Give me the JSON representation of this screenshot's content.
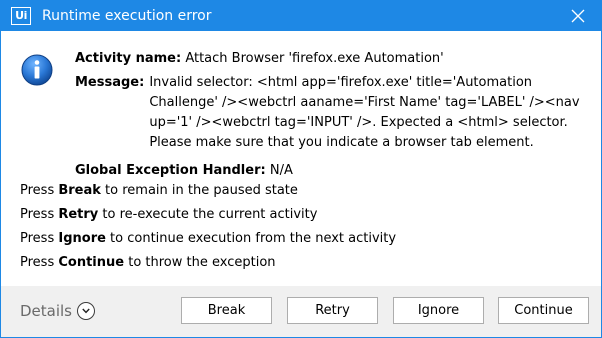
{
  "window": {
    "title": "Runtime execution error",
    "logo_text": "Ui",
    "accent_color": "#1e88e5"
  },
  "icons": {
    "info": "info-icon",
    "close": "close-icon",
    "details_toggle": "chevron-down-icon"
  },
  "error": {
    "activity_label": "Activity name:",
    "activity_value": "Attach Browser 'firefox.exe Automation'",
    "message_label": "Message:",
    "message_value": "Invalid selector: <html app='firefox.exe' title='Automation Challenge' /><webctrl aaname='First Name' tag='LABEL' /><nav up='1' /><webctrl tag='INPUT' />. Expected a <html> selector. Please make sure that you indicate a browser tab element.",
    "handler_label": "Global Exception Handler:",
    "handler_value": "N/A"
  },
  "instructions": [
    {
      "prefix": "Press ",
      "key": "Break",
      "suffix": " to remain in the paused state"
    },
    {
      "prefix": "Press ",
      "key": "Retry",
      "suffix": " to re-execute the current activity"
    },
    {
      "prefix": "Press ",
      "key": "Ignore",
      "suffix": " to continue execution from the next activity"
    },
    {
      "prefix": "Press ",
      "key": "Continue",
      "suffix": " to throw the exception"
    }
  ],
  "footer": {
    "details_label": "Details",
    "buttons": {
      "break": "Break",
      "retry": "Retry",
      "ignore": "Ignore",
      "continue": "Continue"
    }
  }
}
